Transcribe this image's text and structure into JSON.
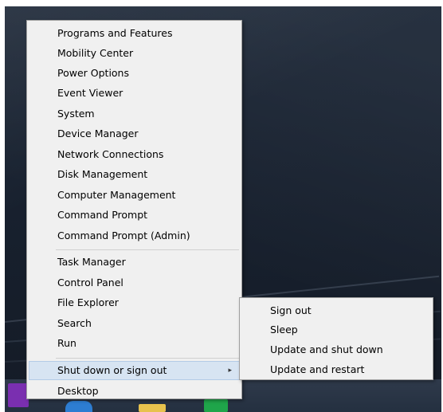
{
  "main_menu": {
    "items": [
      {
        "label": "Programs and Features"
      },
      {
        "label": "Mobility Center"
      },
      {
        "label": "Power Options"
      },
      {
        "label": "Event Viewer"
      },
      {
        "label": "System"
      },
      {
        "label": "Device Manager"
      },
      {
        "label": "Network Connections"
      },
      {
        "label": "Disk Management"
      },
      {
        "label": "Computer Management"
      },
      {
        "label": "Command Prompt"
      },
      {
        "label": "Command Prompt (Admin)"
      },
      {
        "label": "Task Manager"
      },
      {
        "label": "Control Panel"
      },
      {
        "label": "File Explorer"
      },
      {
        "label": "Search"
      },
      {
        "label": "Run"
      },
      {
        "label": "Shut down or sign out"
      },
      {
        "label": "Desktop"
      }
    ],
    "submenu_arrow": "▸"
  },
  "submenu": {
    "items": [
      {
        "label": "Sign out"
      },
      {
        "label": "Sleep"
      },
      {
        "label": "Update and shut down"
      },
      {
        "label": "Update and restart"
      }
    ]
  },
  "colors": {
    "menu_background": "#f0f0f0",
    "hover_background": "#d7e4f2",
    "hover_border": "#b3cbe6",
    "desktop_background": "#18212f",
    "start_button": "#7a2fb0"
  },
  "icons": {
    "start": "windows-start-icon",
    "taskbar_1": "internet-explorer-icon",
    "taskbar_2": "file-explorer-icon",
    "taskbar_3": "store-icon"
  }
}
